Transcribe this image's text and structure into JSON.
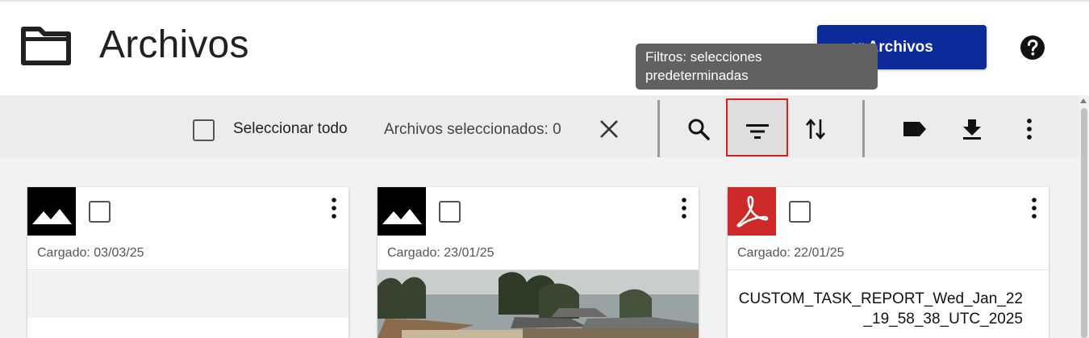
{
  "header": {
    "title": "Archivos",
    "upload_label": "ar Archivos",
    "folder_icon": "folder-icon",
    "help_icon": "help-icon"
  },
  "tooltip": {
    "text": "Filtros: selecciones predeterminadas"
  },
  "toolbar": {
    "select_all_label": "Seleccionar todo",
    "selected_count_label": "Archivos seleccionados: 0",
    "icons": [
      "close-icon",
      "search-icon",
      "filter-icon",
      "sort-icon",
      "tag-icon",
      "download-icon",
      "more-vert-icon"
    ]
  },
  "cards": [
    {
      "type": "image",
      "uploaded": "Cargado: 03/03/25"
    },
    {
      "type": "image",
      "uploaded": "Cargado: 23/01/25"
    },
    {
      "type": "pdf",
      "uploaded": "Cargado: 22/01/25",
      "name": "CUSTOM_TASK_REPORT_Wed_Jan_22_19_58_38_UTC_2025"
    }
  ],
  "colors": {
    "primary": "#0d2a9b",
    "tooltip": "#616161",
    "highlight_border": "#d61f1f",
    "pdf_red": "#cf2a2a"
  }
}
